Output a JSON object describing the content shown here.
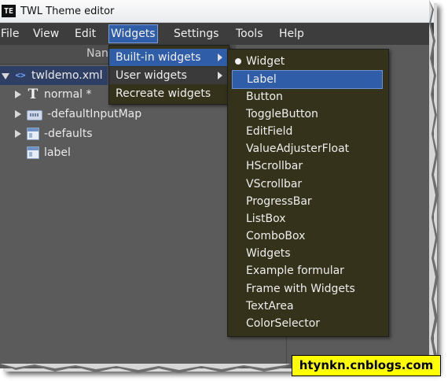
{
  "window": {
    "title": "TWL Theme editor",
    "app_icon": "TE"
  },
  "menubar": {
    "items": [
      "File",
      "View",
      "Edit",
      "Widgets",
      "Settings",
      "Tools",
      "Help"
    ],
    "active": "Widgets"
  },
  "tree": {
    "header_label": "Nan",
    "rows": [
      {
        "label": "twldemo.xml",
        "icon": "code-icon",
        "expander": "open",
        "selected": true
      },
      {
        "label": "normal *",
        "icon": "font-icon",
        "expander": "collapsed"
      },
      {
        "label": "-defaultInputMap",
        "icon": "keyboard-icon",
        "expander": "collapsed"
      },
      {
        "label": "-defaults",
        "icon": "window-icon",
        "expander": "collapsed"
      },
      {
        "label": "label",
        "icon": "window-icon",
        "expander": "none"
      }
    ]
  },
  "widgets_menu": {
    "items": [
      {
        "label": "Built-in widgets",
        "submenu": true,
        "state": "highlight"
      },
      {
        "label": "User widgets",
        "submenu": true,
        "state": "hover"
      },
      {
        "label": "Recreate widgets",
        "submenu": false,
        "state": "normal"
      }
    ]
  },
  "builtin_menu": {
    "items": [
      "Widget",
      "Label",
      "Button",
      "ToggleButton",
      "EditField",
      "ValueAdjusterFloat",
      "HScrollbar",
      "VScrollbar",
      "ProgressBar",
      "ListBox",
      "ComboBox",
      "Widgets",
      "Example formular",
      "Frame with Widgets",
      "TextArea",
      "ColorSelector"
    ],
    "selected_radio": "Widget",
    "highlighted": "Label"
  },
  "watermark": "htynkn.cnblogs.com",
  "colors": {
    "menu_bg": "#34321a",
    "highlight": "#2f5da8",
    "window_bg": "#5b5b5b",
    "menubar_bg": "#3d3d3d",
    "watermark_bg": "#ffff00"
  }
}
